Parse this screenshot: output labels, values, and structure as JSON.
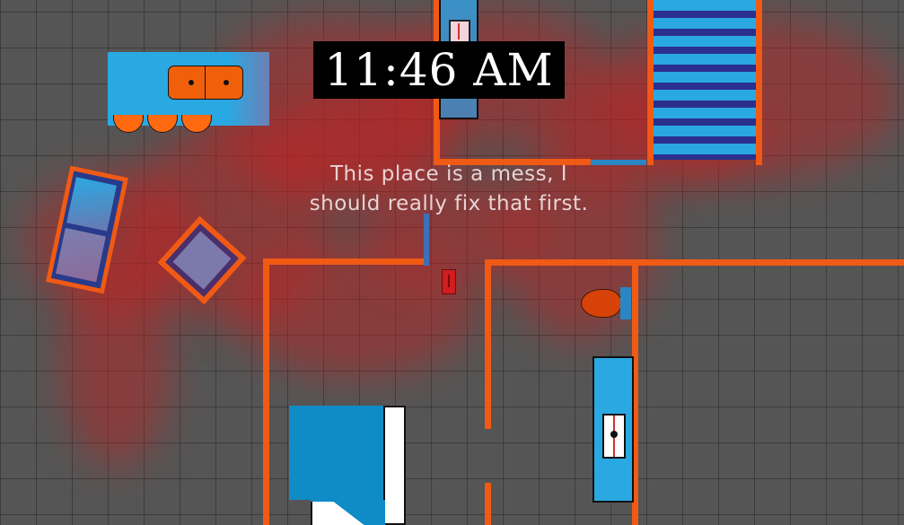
{
  "hud": {
    "clock": "11:46 AM"
  },
  "dialogue": {
    "message": "This place is a mess, I should really fix that first."
  },
  "colors": {
    "floor": "#555555",
    "grid": "#3f3f3f",
    "wall": "#f05a14",
    "furniture_blue": "#29a8e0",
    "bed_stripe_dark": "#2b2f8e",
    "blood": "#c81e1e",
    "clock_bg": "#000000",
    "clock_text": "#ffffff"
  },
  "scene": {
    "objects": [
      "kitchen-counter",
      "stove",
      "striped-bed",
      "tilted-cabinet",
      "tilted-crate",
      "fridge",
      "desk",
      "toilet",
      "red-item",
      "tall-cabinet",
      "desk-lamp"
    ]
  }
}
